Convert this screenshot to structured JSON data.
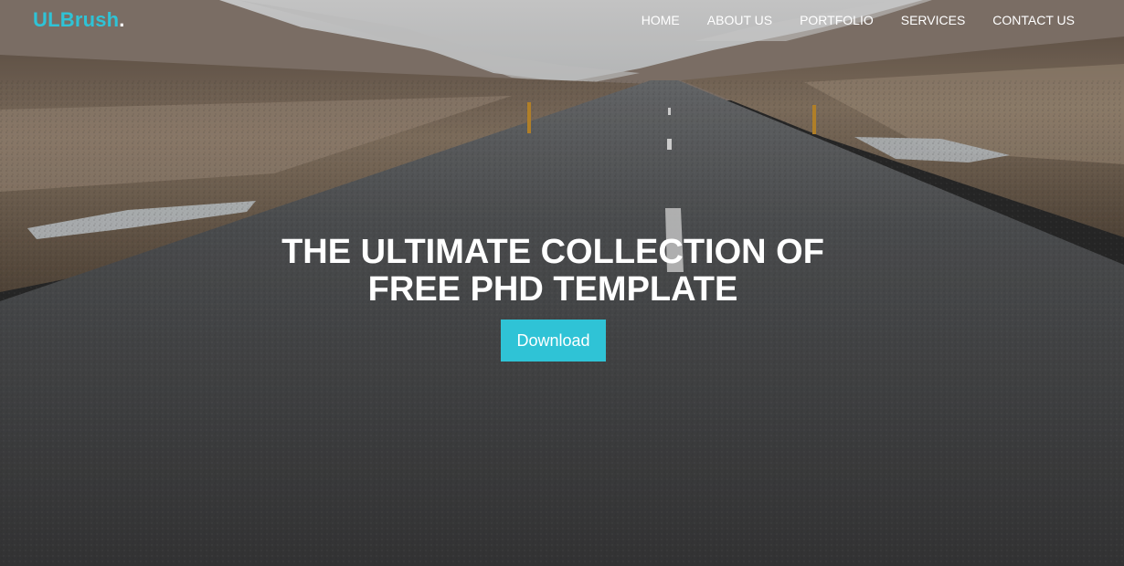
{
  "brand": {
    "name": "ULBrush",
    "dot": ".",
    "accent": "#2fc3d6"
  },
  "nav": {
    "items": [
      "HOME",
      "ABOUT US",
      "PORTFOLIO",
      "SERVICES",
      "CONTACT US"
    ]
  },
  "hero": {
    "headline_line1": "THE ULTIMATE COLLECTION OF",
    "headline_line2": "FREE PHD TEMPLATE",
    "cta_label": "Download",
    "background": "empty-road-landscape-photo"
  }
}
